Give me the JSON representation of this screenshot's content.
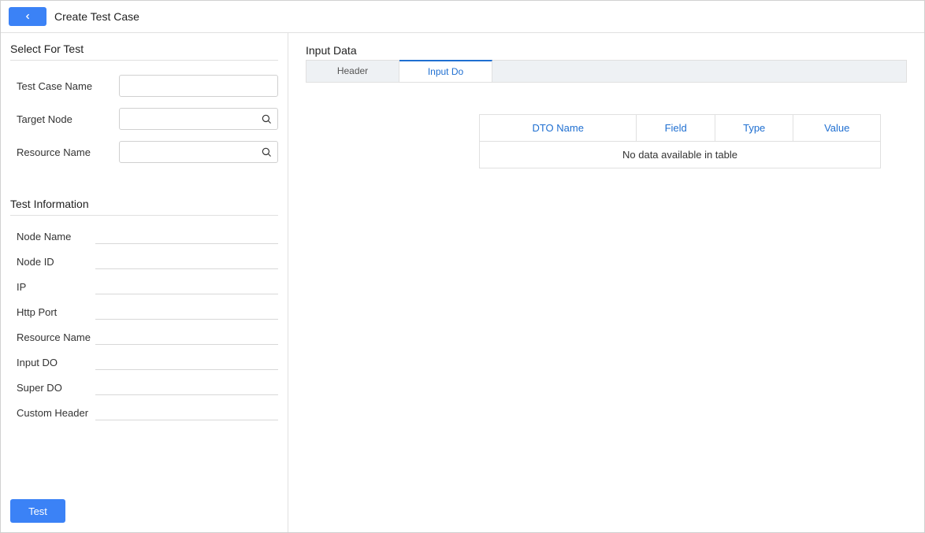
{
  "header": {
    "title": "Create Test Case"
  },
  "left": {
    "selectSectionTitle": "Select For Test",
    "testCaseNameLabel": "Test Case Name",
    "testCaseNameValue": "",
    "targetNodeLabel": "Target Node",
    "targetNodeValue": "",
    "resourceNameLabel": "Resource Name",
    "resourceNameValue": "",
    "infoSectionTitle": "Test Information",
    "infoRows": [
      {
        "label": "Node Name",
        "value": ""
      },
      {
        "label": "Node ID",
        "value": ""
      },
      {
        "label": "IP",
        "value": ""
      },
      {
        "label": "Http Port",
        "value": ""
      },
      {
        "label": "Resource Name",
        "value": ""
      },
      {
        "label": "Input DO",
        "value": ""
      },
      {
        "label": "Super DO",
        "value": ""
      },
      {
        "label": "Custom Header",
        "value": ""
      }
    ],
    "testButtonLabel": "Test"
  },
  "right": {
    "sectionTitle": "Input Data",
    "tabs": [
      {
        "label": "Header",
        "active": false
      },
      {
        "label": "Input Do",
        "active": true
      }
    ],
    "table": {
      "columns": [
        "DTO Name",
        "Field",
        "Type",
        "Value"
      ],
      "emptyMessage": "No data available in table"
    }
  }
}
